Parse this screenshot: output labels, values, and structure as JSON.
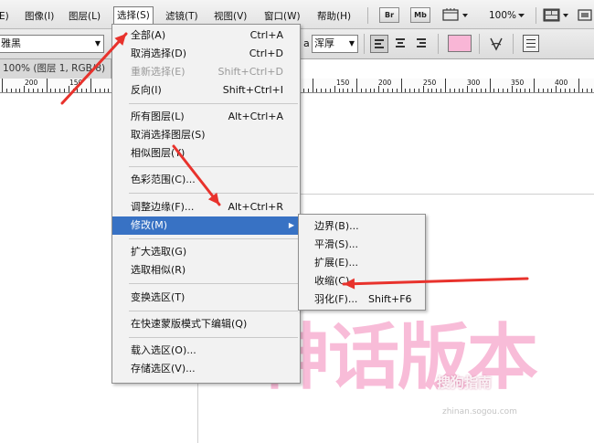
{
  "menubar": {
    "items": [
      {
        "label": "E)"
      },
      {
        "label": "图像(I)"
      },
      {
        "label": "图层(L)"
      },
      {
        "label": "选择(S)"
      },
      {
        "label": "滤镜(T)"
      },
      {
        "label": "视图(V)"
      },
      {
        "label": "窗口(W)"
      },
      {
        "label": "帮助(H)"
      }
    ],
    "bridge_badge": "Br",
    "minibridge_badge": "Mb",
    "zoom": "100%",
    "icons": [
      "bridge-icon",
      "mini-bridge-icon",
      "extras-icon",
      "zoom-dropdown-icon",
      "arrange-documents-icon",
      "screen-mode-icon"
    ]
  },
  "options_bar": {
    "font_family": "雅黑",
    "font_style_fragment": "a",
    "antialias": "浑厚",
    "text_color": "#f9b6d6",
    "icons": [
      "align-left-icon",
      "align-center-icon",
      "align-right-icon",
      "warp-text-icon",
      "character-panel-icon"
    ]
  },
  "document": {
    "tab": "100% (图层 1, RGB/8)",
    "ruler_labels": [
      "200",
      "150",
      "150",
      "200",
      "250",
      "300",
      "350",
      "400"
    ],
    "canvas_text": "神话版本",
    "watermark": "搜狗指南",
    "watermark_url": "zhinan.sogou.com"
  },
  "select_menu": {
    "items": [
      {
        "label": "全部(A)",
        "shortcut": "Ctrl+A",
        "state": "normal"
      },
      {
        "label": "取消选择(D)",
        "shortcut": "Ctrl+D",
        "state": "normal"
      },
      {
        "label": "重新选择(E)",
        "shortcut": "Shift+Ctrl+D",
        "state": "disabled"
      },
      {
        "label": "反向(I)",
        "shortcut": "Shift+Ctrl+I",
        "state": "normal"
      },
      {
        "label": "所有图层(L)",
        "shortcut": "Alt+Ctrl+A",
        "state": "normal"
      },
      {
        "label": "取消选择图层(S)",
        "shortcut": "",
        "state": "normal"
      },
      {
        "label": "相似图层(Y)",
        "shortcut": "",
        "state": "normal"
      },
      {
        "label": "色彩范围(C)...",
        "shortcut": "",
        "state": "normal"
      },
      {
        "label": "调整边缘(F)...",
        "shortcut": "Alt+Ctrl+R",
        "state": "normal"
      },
      {
        "label": "修改(M)",
        "shortcut": "",
        "state": "highlight"
      },
      {
        "label": "扩大选取(G)",
        "shortcut": "",
        "state": "normal"
      },
      {
        "label": "选取相似(R)",
        "shortcut": "",
        "state": "normal"
      },
      {
        "label": "变换选区(T)",
        "shortcut": "",
        "state": "normal"
      },
      {
        "label": "在快速蒙版模式下编辑(Q)",
        "shortcut": "",
        "state": "normal"
      },
      {
        "label": "载入选区(O)...",
        "shortcut": "",
        "state": "normal"
      },
      {
        "label": "存储选区(V)...",
        "shortcut": "",
        "state": "normal"
      }
    ]
  },
  "modify_submenu": {
    "items": [
      {
        "label": "边界(B)...",
        "shortcut": ""
      },
      {
        "label": "平滑(S)...",
        "shortcut": ""
      },
      {
        "label": "扩展(E)...",
        "shortcut": ""
      },
      {
        "label": "收缩(C)...",
        "shortcut": ""
      },
      {
        "label": "羽化(F)...",
        "shortcut": "Shift+F6"
      }
    ]
  },
  "colors": {
    "annotation_arrow": "#e8322c",
    "menu_highlight": "#3872c4",
    "text_pink": "#f8bcd8"
  }
}
